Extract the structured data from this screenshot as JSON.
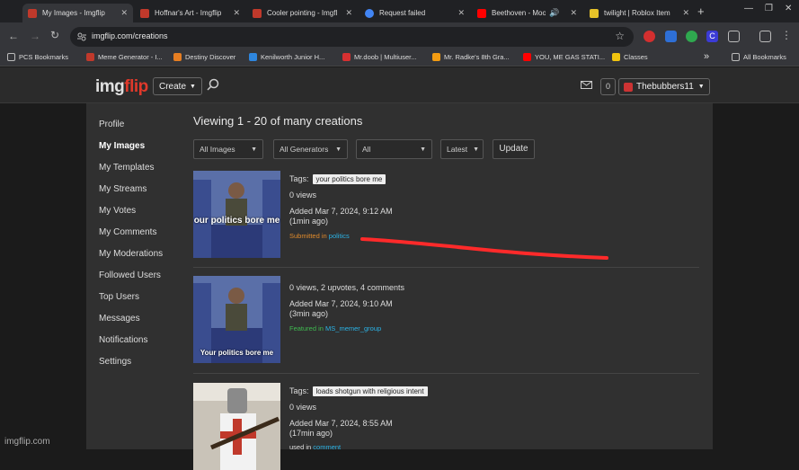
{
  "browser": {
    "tabs": [
      {
        "title": "My Images - Imgflip",
        "color": "#c0392b"
      },
      {
        "title": "Hoffnar's Art - Imgflip",
        "color": "#c0392b"
      },
      {
        "title": "Cooler pointing - Imgfl",
        "color": "#c0392b"
      },
      {
        "title": "Request failed",
        "color": "#4285f4"
      },
      {
        "title": "Beethoven - Moonl",
        "color": "#ff0000"
      },
      {
        "title": "twilight | Roblox Item",
        "color": "#e6c229"
      }
    ],
    "new_tab": "+",
    "address": "imgflip.com/creations",
    "bookmarks": [
      {
        "label": "PCS Bookmarks",
        "color": "#999"
      },
      {
        "label": "Meme Generator - I...",
        "color": "#c0392b"
      },
      {
        "label": "Destiny Discover",
        "color": "#e67e22"
      },
      {
        "label": "Kenilworth Junior H...",
        "color": "#2e86de"
      },
      {
        "label": "Mr.doob | Multiuser...",
        "color": "#d63031"
      },
      {
        "label": "Mr. Radke's 8th Gra...",
        "color": "#f39c12"
      },
      {
        "label": "YOU, ME GAS STATI...",
        "color": "#ff0000"
      },
      {
        "label": "Classes",
        "color": "#f1c40f"
      }
    ],
    "bookmarks_overflow": "»",
    "all_bookmarks": "All Bookmarks"
  },
  "site": {
    "logo_a": "img",
    "logo_b": "flip",
    "create_label": "Create",
    "notif_count": "0",
    "username": "Thebubbers11"
  },
  "sidebar": [
    {
      "label": "Profile"
    },
    {
      "label": "My Images",
      "active": true
    },
    {
      "label": "My Templates"
    },
    {
      "label": "My Streams"
    },
    {
      "label": "My Votes"
    },
    {
      "label": "My Comments"
    },
    {
      "label": "My Moderations"
    },
    {
      "label": "Followed Users"
    },
    {
      "label": "Top Users"
    },
    {
      "label": "Messages"
    },
    {
      "label": "Notifications"
    },
    {
      "label": "Settings"
    }
  ],
  "main": {
    "heading": "Viewing 1 - 20 of many creations",
    "filters": [
      "All Images",
      "All Generators",
      "All",
      "Latest"
    ],
    "update_label": "Update"
  },
  "items": [
    {
      "tags_label": "Tags:",
      "tag": "your politics bore me",
      "views": "0 views",
      "added": "Added Mar 7, 2024, 9:12 AM",
      "ago": "(1min ago)",
      "status_prefix": "Submitted in",
      "status_link": "politics",
      "thumb_caption": "our politics bore me"
    },
    {
      "stats": "0 views, 2 upvotes, 4 comments",
      "added": "Added Mar 7, 2024, 9:10 AM",
      "ago": "(3min ago)",
      "status_prefix": "Featured in",
      "status_link": "MS_memer_group",
      "thumb_caption": "Your politics bore me"
    },
    {
      "tags_label": "Tags:",
      "tag": "loads shotgun with religious intent",
      "views": "0 views",
      "added": "Added Mar 7, 2024, 8:55 AM",
      "ago": "(17min ago)",
      "status_prefix": "used in",
      "status_link": "comment"
    }
  ],
  "watermark": "imgflip.com",
  "colors": {
    "red_scribble": "#ff2a2a",
    "orange": "#e08a2c",
    "cyan": "#2bb3e6",
    "green": "#3fb950"
  }
}
